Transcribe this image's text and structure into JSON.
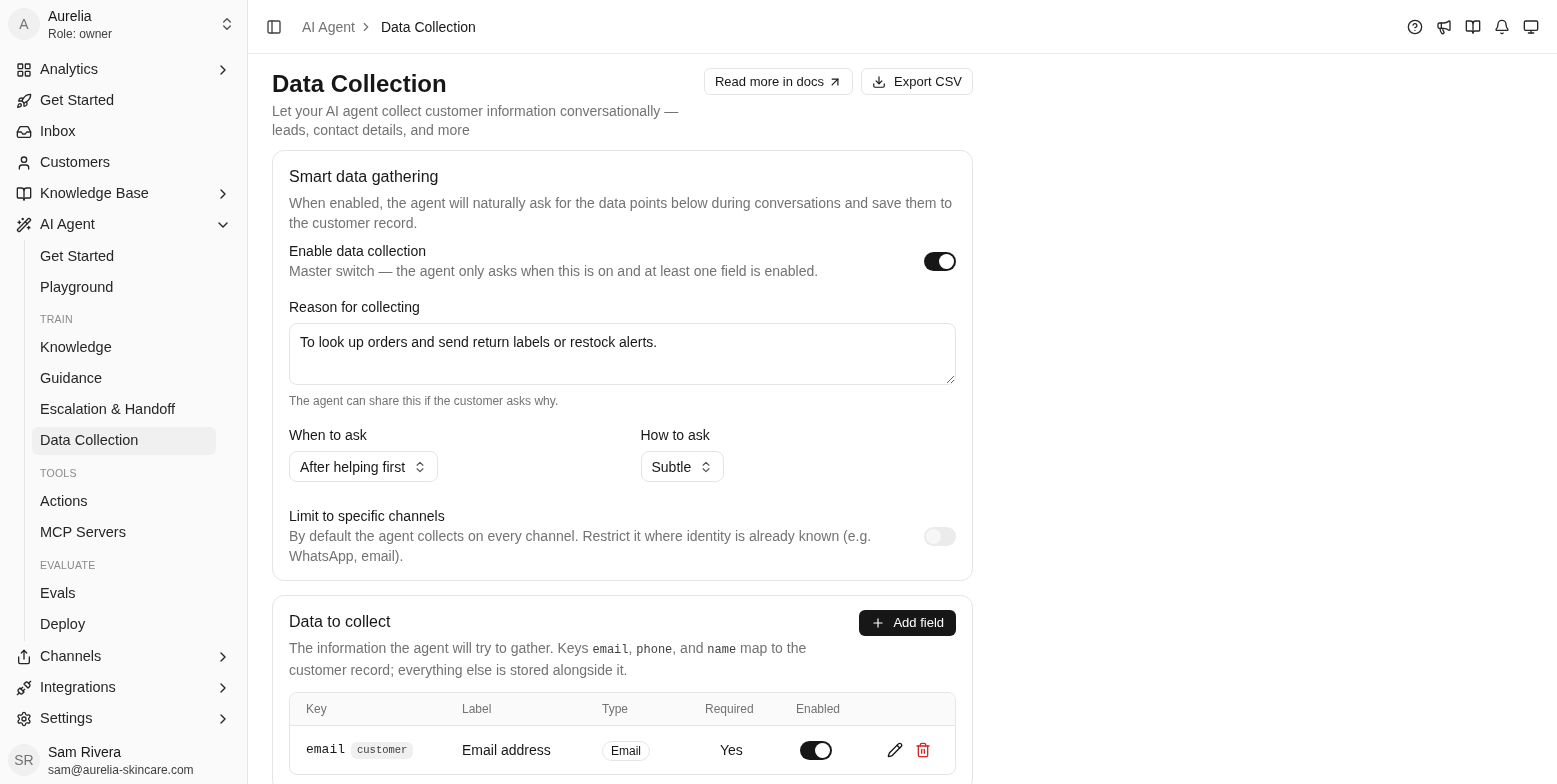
{
  "workspace": {
    "avatar": "A",
    "name": "Aurelia",
    "role": "Role: owner"
  },
  "nav": [
    {
      "label": "Analytics",
      "expanded": false
    },
    {
      "label": "Get Started"
    },
    {
      "label": "Inbox"
    },
    {
      "label": "Customers"
    },
    {
      "label": "Knowledge Base",
      "expanded": false
    },
    {
      "label": "AI Agent",
      "expanded": true,
      "children": [
        {
          "kind": "link",
          "label": "Get Started",
          "selected": false
        },
        {
          "kind": "link",
          "label": "Playground",
          "selected": false
        },
        {
          "kind": "section",
          "label": "TRAIN"
        },
        {
          "kind": "link",
          "label": "Knowledge",
          "selected": false
        },
        {
          "kind": "link",
          "label": "Guidance",
          "selected": false
        },
        {
          "kind": "link",
          "label": "Escalation & Handoff",
          "selected": false
        },
        {
          "kind": "link",
          "label": "Data Collection",
          "selected": true
        },
        {
          "kind": "section",
          "label": "TOOLS"
        },
        {
          "kind": "link",
          "label": "Actions",
          "selected": false
        },
        {
          "kind": "link",
          "label": "MCP Servers",
          "selected": false
        },
        {
          "kind": "section",
          "label": "EVALUATE"
        },
        {
          "kind": "link",
          "label": "Evals",
          "selected": false
        },
        {
          "kind": "link",
          "label": "Deploy",
          "selected": false
        }
      ]
    },
    {
      "label": "Channels",
      "expanded": false
    },
    {
      "label": "Integrations",
      "expanded": false
    },
    {
      "label": "Settings",
      "expanded": false
    }
  ],
  "user": {
    "avatar": "SR",
    "name": "Sam Rivera",
    "email": "sam@aurelia-skincare.com"
  },
  "breadcrumb": [
    "AI Agent",
    "Data Collection"
  ],
  "page": {
    "title": "Data Collection",
    "subtitle": "Let your AI agent collect customer information conversationally — leads, contact details, and more",
    "buttons": [
      "Read more in docs",
      "Export CSV"
    ]
  },
  "gathering": {
    "title": "Smart data gathering",
    "description": "When enabled, the agent will naturally ask for the data points below during conversations and save them to the customer record.",
    "enable": {
      "label": "Enable data collection",
      "description": "Master switch — the agent only asks when this is on and at least one field is enabled.",
      "on": true
    },
    "reason": {
      "label": "Reason for collecting",
      "value": "To look up orders and send return labels or restock alerts.",
      "hint": "The agent can share this if the customer asks why."
    },
    "when": {
      "label": "When to ask",
      "value": "After helping first"
    },
    "how": {
      "label": "How to ask",
      "value": "Subtle"
    },
    "limit": {
      "label": "Limit to specific channels",
      "description": "By default the agent collects on every channel. Restrict it where identity is already known (e.g. WhatsApp, email).",
      "on": false
    }
  },
  "collect": {
    "title": "Data to collect",
    "button": "Add field",
    "description": [
      {
        "kind": "text",
        "text": "The information the agent will try to gather. Keys "
      },
      {
        "kind": "code",
        "text": "email"
      },
      {
        "kind": "text",
        "text": ", "
      },
      {
        "kind": "code",
        "text": "phone"
      },
      {
        "kind": "text",
        "text": ", and "
      },
      {
        "kind": "code",
        "text": "name"
      },
      {
        "kind": "text",
        "text": " map to the customer record; everything else is stored alongside it."
      }
    ],
    "columns": [
      "Key",
      "Label",
      "Type",
      "Required",
      "Enabled"
    ],
    "rows": [
      {
        "key": "email",
        "tag": "customer",
        "label": "Email address",
        "type": "Email",
        "required": "Yes",
        "enabled": true
      }
    ]
  }
}
